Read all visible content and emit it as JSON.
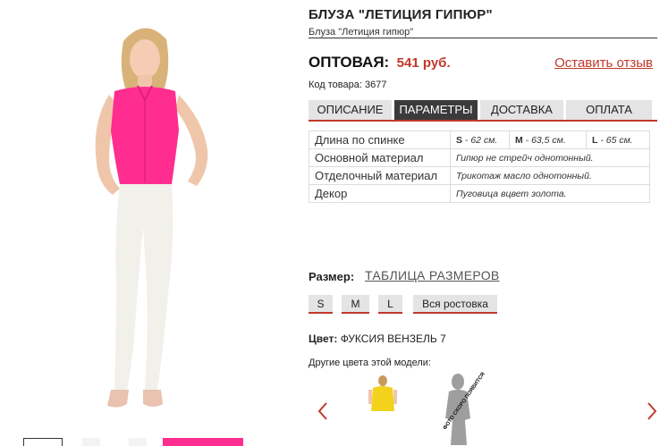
{
  "product": {
    "title": "БЛУЗА \"ЛЕТИЦИЯ ГИПЮР\"",
    "subtitle": "Блуза \"Летиция гипюр\""
  },
  "price": {
    "label": "ОПТОВАЯ:",
    "value": "541 руб."
  },
  "review_link": "Оставить отзыв",
  "sku": "Код товара: 3677",
  "tabs": [
    {
      "label": "ОПИСАНИЕ",
      "active": false
    },
    {
      "label": "ПАРАМЕТРЫ",
      "active": true
    },
    {
      "label": "ДОСТАВКА",
      "active": false
    },
    {
      "label": "ОПЛАТА",
      "active": false
    }
  ],
  "params": {
    "length": {
      "label": "Длина по спинке",
      "s_size": "S",
      "s_value": " - 62 см.",
      "m_size": "M",
      "m_value": " - 63,5 см.",
      "l_size": "L",
      "l_value": " - 65 см."
    },
    "rows": [
      {
        "label": "Основной материал",
        "value": "Гипюр не стрейч однотонный."
      },
      {
        "label": "Отделочный материал",
        "value": "Трикотаж масло однотонный."
      },
      {
        "label": "Декор",
        "value": "Пуговица вцвет золота."
      }
    ]
  },
  "size": {
    "label": "Размер:",
    "table_link": "ТАБЛИЦА РАЗМЕРОВ",
    "options": [
      "S",
      "M",
      "L",
      "Вся ростовка"
    ]
  },
  "color": {
    "label": "Цвет:",
    "value": "ФУКСИЯ ВЕНЗЕЛЬ 7",
    "other_label": "Другие цвета этой модели:",
    "soon_text": "ФОТО СКОРО ПОЯВИТСЯ"
  },
  "colors": {
    "accent": "#c0392b",
    "blouse": "#ff2d8f",
    "yellow": "#f2d21b",
    "tab_active": "#3b3b3b",
    "tab_inactive": "#e4e4e4"
  },
  "icons": {
    "prev": "chevron-left-icon",
    "next": "chevron-right-icon"
  }
}
